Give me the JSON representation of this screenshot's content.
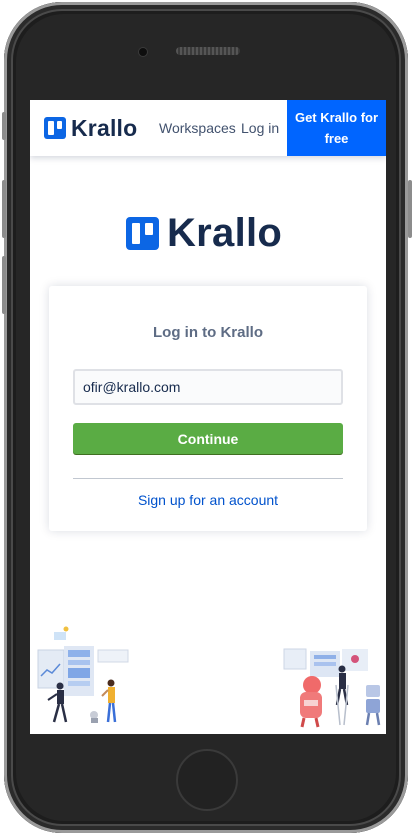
{
  "header": {
    "logo_text": "Krallo",
    "nav": {
      "workspaces": "Workspaces",
      "login": "Log in"
    },
    "cta_label": "Get Krallo for free"
  },
  "main": {
    "logo_text": "Krallo",
    "card": {
      "title": "Log in to Krallo",
      "email_value": "ofir@krallo.com",
      "continue_label": "Continue",
      "signup_label": "Sign up for an account"
    }
  },
  "colors": {
    "brand_blue": "#0c66e4",
    "cta_blue": "#0065ff",
    "continue_green": "#5aac44",
    "link_blue": "#0052cc"
  },
  "icons": {
    "logo": "krallo-board-icon",
    "left_illustration": "team-working-illustration",
    "right_illustration": "board-planning-illustration"
  }
}
